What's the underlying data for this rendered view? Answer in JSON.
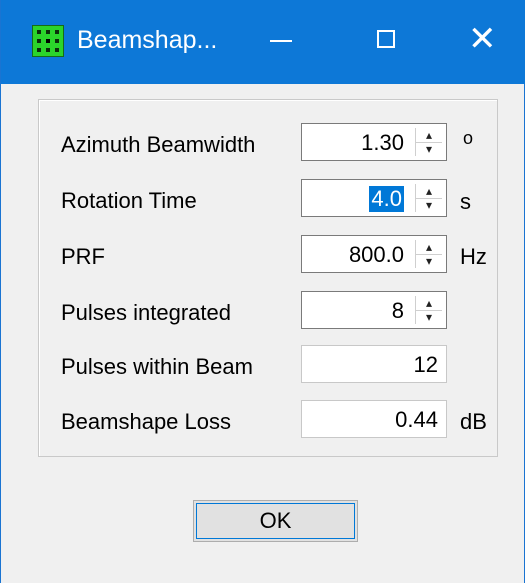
{
  "window": {
    "title": "Beamshap...",
    "icon": "radar-grid-icon",
    "controls": {
      "minimize_label": "—",
      "maximize_label": "☐",
      "close_label": "✕"
    }
  },
  "form": {
    "azimuth_beamwidth": {
      "label": "Azimuth Beamwidth",
      "value": "1.30",
      "unit": "o"
    },
    "rotation_time": {
      "label": "Rotation Time",
      "value": "4.0",
      "unit": "s",
      "selected": true
    },
    "prf": {
      "label": "PRF",
      "value": "800.0",
      "unit": "Hz"
    },
    "pulses_integrated": {
      "label": "Pulses integrated",
      "value": "8"
    },
    "pulses_within_beam": {
      "label": "Pulses within Beam",
      "value": "12"
    },
    "beamshape_loss": {
      "label": "Beamshape Loss",
      "value": "0.44",
      "unit": "dB"
    }
  },
  "spinner_glyphs": {
    "up": "▴",
    "down": "▾"
  },
  "ok_button": {
    "label": "OK"
  },
  "colors": {
    "titlebar": "#0d78d7",
    "selection": "#0078d7",
    "icon_green": "#2bd42b"
  }
}
